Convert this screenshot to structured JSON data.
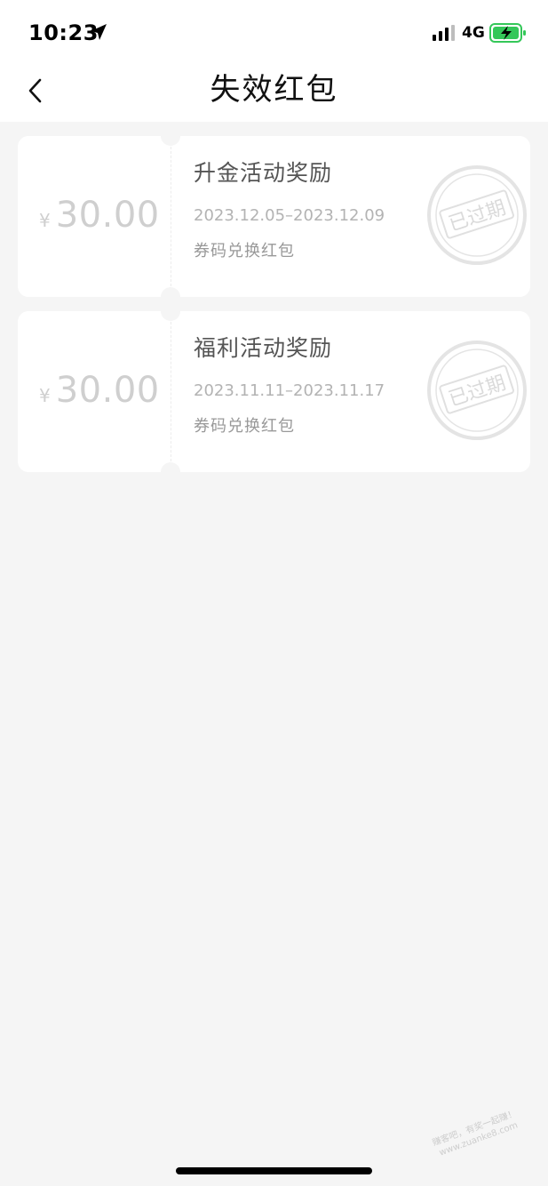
{
  "status_bar": {
    "time": "10:23",
    "network": "4G"
  },
  "header": {
    "title": "失效红包"
  },
  "coupons": [
    {
      "currency": "¥",
      "amount": "30.00",
      "title": "升金活动奖励",
      "date_range": "2023.12.05–2023.12.09",
      "type": "券码兑换红包",
      "stamp": "已过期"
    },
    {
      "currency": "¥",
      "amount": "30.00",
      "title": "福利活动奖励",
      "date_range": "2023.11.11–2023.11.17",
      "type": "券码兑换红包",
      "stamp": "已过期"
    }
  ],
  "watermark": {
    "line1": "赚客吧，有奖一起赚！",
    "line2": "www.zuanke8.com"
  },
  "colors": {
    "background": "#f5f5f5",
    "card": "#ffffff",
    "amount_gray": "#cfcfcf",
    "battery_green": "#34c759"
  }
}
